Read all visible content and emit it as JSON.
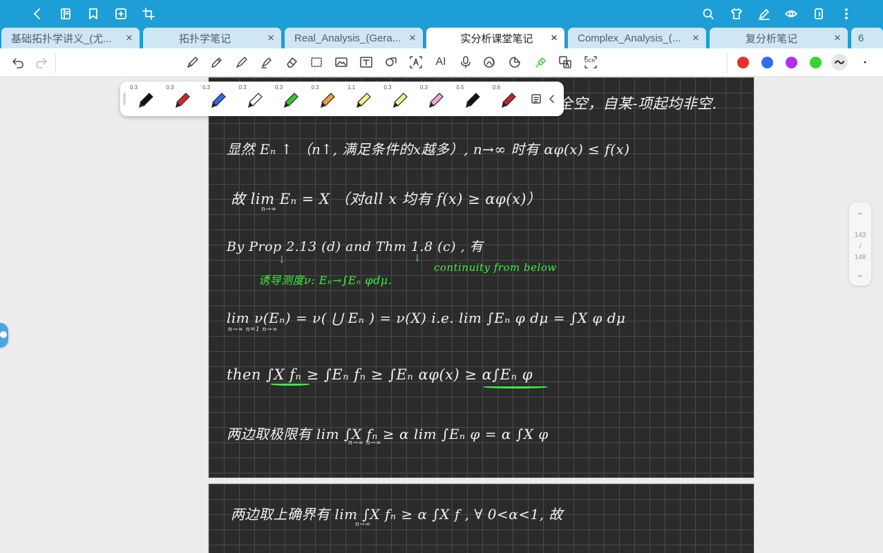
{
  "tabs": [
    {
      "label": "基础拓扑学讲义_(尤...",
      "active": false
    },
    {
      "label": "拓扑学笔记",
      "active": false
    },
    {
      "label": "Real_Analysis_(Gera...",
      "active": false
    },
    {
      "label": "实分析课堂笔记",
      "active": true
    },
    {
      "label": "Complex_Analysis_(...",
      "active": false
    },
    {
      "label": "复分析笔记",
      "active": false
    },
    {
      "label": "6",
      "active": false
    }
  ],
  "tab_close": "×",
  "toolbar": {
    "text_tool": "T",
    "ai_tool": "AI",
    "ocr_tool": "OCR"
  },
  "colors": {
    "topbar": "#1e9ed6",
    "red": "#e8302a",
    "blue": "#2f6df0",
    "purple": "#b42ee8",
    "green": "#35d42e",
    "ink": "#f2f2f2",
    "ink_green": "#3cf03a"
  },
  "pen_palette": {
    "pens": [
      {
        "size": "0.3",
        "color": "#111111"
      },
      {
        "size": "0.3",
        "color": "#d7262b"
      },
      {
        "size": "0.3",
        "color": "#2f6df0"
      },
      {
        "size": "0.3",
        "color": "#ffffff"
      },
      {
        "size": "0.3",
        "color": "#35c92e"
      },
      {
        "size": "0.3",
        "color": "#f0a23a"
      },
      {
        "size": "1.1",
        "color": "#f5ef8a"
      },
      {
        "size": "0.3",
        "color": "#f2ee8c"
      },
      {
        "size": "0.3",
        "color": "#f2a8d8"
      },
      {
        "size": "0.5",
        "color": "#111111"
      },
      {
        "size": "0.6",
        "color": "#c5222a"
      }
    ]
  },
  "scroller": {
    "current": "143",
    "sep": "/",
    "total": "148",
    "up": "⌃",
    "down": "⌄"
  },
  "notes": {
    "line0": "全空，自某-项起均非空.",
    "line1": "显然 Eₙ ↑ （n↑, 满足条件的x越多）,   n→∞ 时有 αφ(x) ≤ f(x)",
    "line2": "故  lim Eₙ = X     （对all x 均有 f(x) ≥ αφ(x)）",
    "line2_sub": "n→∞",
    "line3": "By  Prop 2.13 (d)    and    Thm 1.8 (c)   , 有",
    "note_a": "诱导测度ν:  Eₙ→∫Eₙ φdμ.",
    "note_b": "continuity  from  below",
    "line4": "lim ν(Eₙ) = ν( ⋃ Eₙ ) = ν(X)     i.e.   lim ∫Eₙ φ dμ  =  ∫X φ dμ",
    "line4_sub": "n→∞              n=1                       n→∞",
    "line5": "then  ∫X fₙ  ≥ ∫Eₙ fₙ    ≥ ∫Eₙ αφ(x)   ≥  α∫Eₙ φ",
    "line6": "两边取极限有      lim ∫X fₙ ≥  α  lim ∫Eₙ φ  =  α ∫X φ",
    "line6_sub": "n→∞                 n→∞",
    "line7": "两边取上确界有     lim ∫X fₙ ≥ α ∫X f      , ∀ 0<α<1,  故",
    "line7_sub": "n→∞"
  }
}
